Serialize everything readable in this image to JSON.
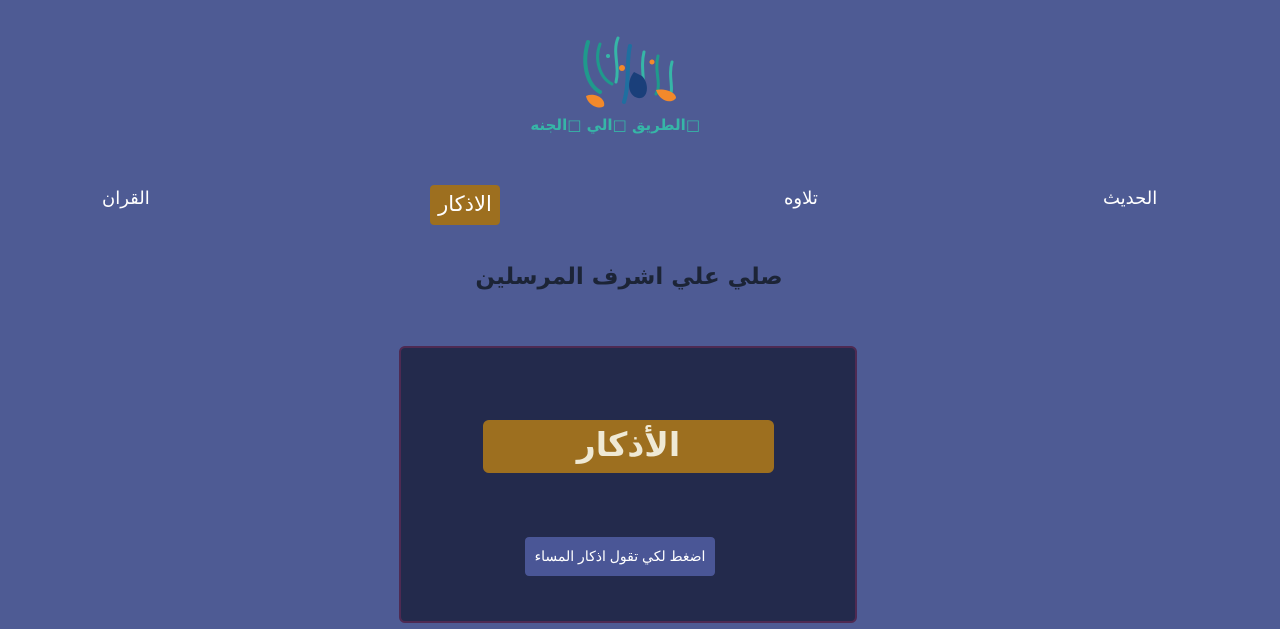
{
  "logo": {
    "text": "□الطريق □الي □الجنه"
  },
  "nav": {
    "items": [
      {
        "label": "الحديث"
      },
      {
        "label": "تلاوه"
      },
      {
        "label": "الاذكار",
        "active": true
      },
      {
        "label": "القران"
      }
    ]
  },
  "main": {
    "headline": "صلي علي اشرف المرسلين",
    "card": {
      "title": "الأذكار",
      "button_label": "اضغط لكي تقول اذكار المساء"
    }
  },
  "colors": {
    "background": "#4e5b94",
    "accent": "#9d6f1f",
    "card": "#232a4c",
    "card_button": "#4a5696",
    "logo_teal": "#36b6a7",
    "logo_orange": "#f2892b"
  }
}
